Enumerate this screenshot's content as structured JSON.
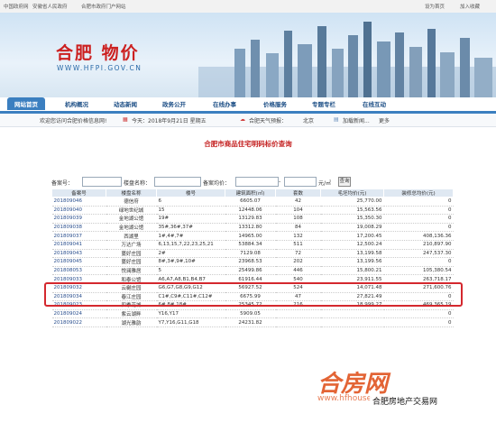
{
  "topbar": {
    "links": [
      "中国政府网",
      "安徽省人民政府",
      "合肥市政府门户网站"
    ],
    "right": [
      "设为首页",
      "加入收藏"
    ]
  },
  "banner": {
    "title": "合肥 物价",
    "url": "WWW.HFPI.GOV.CN"
  },
  "nav": {
    "tabs": [
      "网站首页",
      "机构概况",
      "动态新闻",
      "政务公开",
      "在线办事",
      "价格服务",
      "专题专栏",
      "在线互动"
    ]
  },
  "infobar": {
    "welcome": "欢迎您访问合肥价格信息网!",
    "today": "今天：2018年9月21日 星期五",
    "weather_label": "合肥天气预报：",
    "city": "北京",
    "bookmark": "加载新闻...",
    "more": "更多"
  },
  "page": {
    "title": "合肥市商品住宅明码标价查询"
  },
  "search": {
    "record_label": "备案号：",
    "project_label": "楼盘名称：",
    "avg_label": "备案均价：",
    "unit": "元/㎡",
    "button": "查询"
  },
  "table": {
    "headers": [
      "备案号",
      "楼盘名称",
      "楼号",
      "建筑面积(㎡)",
      "套数",
      "毛坯均价(元)",
      "装修总均价(元)"
    ],
    "rows": [
      [
        "201809046",
        "德信府",
        "6",
        "6605.07",
        "42",
        "25,770.00",
        "0"
      ],
      [
        "201809040",
        "绿地世纪城",
        "15",
        "12448.06",
        "104",
        "15,563.56",
        "0"
      ],
      [
        "201809039",
        "金地湖公馆",
        "19#",
        "13129.83",
        "108",
        "15,350.30",
        "0"
      ],
      [
        "201809038",
        "金地湖公馆",
        "35#,36#,37#",
        "13312.80",
        "84",
        "19,008.29",
        "0"
      ],
      [
        "201809037",
        "西湖里",
        "1#,4#,7#",
        "14965.00",
        "132",
        "17,200.45",
        "408,136.36"
      ],
      [
        "201809041",
        "万达广场",
        "6,13,15,7,22,23,25,21",
        "53884.34",
        "511",
        "12,500.24",
        "210,897.90"
      ],
      [
        "201809043",
        "蔓好庄园",
        "2#",
        "7129.08",
        "72",
        "13,199.58",
        "247,537.30"
      ],
      [
        "201809045",
        "蔓好庄园",
        "8#,3#,9#,10#",
        "23968.53",
        "202",
        "13,199.56",
        "0"
      ],
      [
        "201808053",
        "悦澜雅居",
        "5",
        "25499.86",
        "446",
        "15,800.21",
        "105,380.54"
      ],
      [
        "201809033",
        "和泰公馆",
        "A6,A7,A8,B1,B4,B7",
        "61916.44",
        "540",
        "23,911.55",
        "263,718.17"
      ],
      [
        "201809032",
        "云樾庄园",
        "G6,G7,G8,G9,G12",
        "56927.52",
        "524",
        "14,071.48",
        "271,600.76"
      ],
      [
        "201809034",
        "春江庄园",
        "C1#,C9#,C11#,C12#",
        "6675.99",
        "47",
        "27,821.49",
        "0"
      ],
      [
        "201809023",
        "四季花城",
        "6#,8#,18#",
        "25345.72",
        "216",
        "18,999.27",
        "469,365.19"
      ],
      [
        "201809024",
        "紫云湖畔",
        "Y16,Y17",
        "5909.05",
        "",
        "",
        "0"
      ],
      [
        "201809022",
        "湖光雅韵",
        "Y7,Y16,G11,G18",
        "24231.82",
        "",
        "",
        "0"
      ]
    ]
  },
  "watermark": {
    "logo": "合房网",
    "sub": "www.hfhouse.com",
    "badge": "合肥房地产交易网"
  },
  "colors": {
    "accent": "#3b7fc0",
    "title_red": "#c42020",
    "highlight_border": "#d4282e"
  }
}
